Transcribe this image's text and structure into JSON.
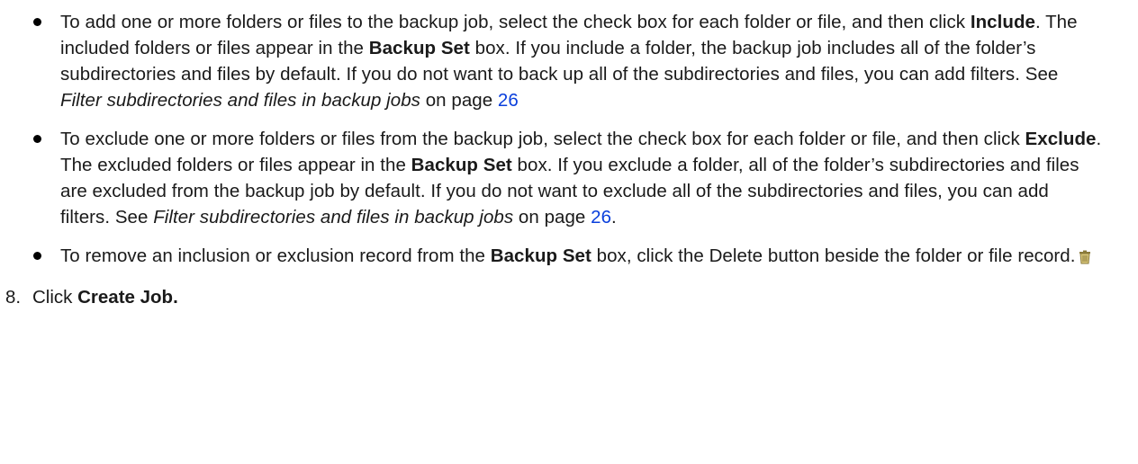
{
  "bullets": [
    {
      "t1": "To add one or more folders or files to the backup job, select the check box for each folder or file, and then click ",
      "b1": "Include",
      "t2": ". The included folders or files appear in the ",
      "b2": "Backup Set",
      "t3": " box. If you include a folder, the backup job includes all of the folder’s subdirectories and files by default. If you do not want to back up all of the subdirectories and files, you can add filters. See ",
      "i1": "Filter subdirectories and files in backup jobs",
      "t4": " on page ",
      "link": "26",
      "t5": ""
    },
    {
      "t1": "To exclude one or more folders or files from the backup job, select the check box for each folder or file, and then click ",
      "b1": "Exclude",
      "t2": ". The excluded folders or files appear in the ",
      "b2": "Backup Set",
      "t3": " box. If you exclude a folder, all of the folder’s subdirectories and files are excluded from the backup job by default. If you do not want to exclude all of the subdirectories and files, you can add filters. See ",
      "i1": "Filter subdirectories and files in backup jobs",
      "t4": " on page ",
      "link": "26",
      "t5": "."
    },
    {
      "t1": "To remove an inclusion or exclusion record from the ",
      "b1": "Backup Set",
      "t2": " box, click the Delete button beside the folder or file record.",
      "icon": "trash-icon"
    }
  ],
  "step": {
    "number": "8.",
    "prefix": "Click ",
    "bold": "Create Job."
  },
  "colors": {
    "link": "#0a3fdc",
    "text": "#1a1a1a"
  }
}
